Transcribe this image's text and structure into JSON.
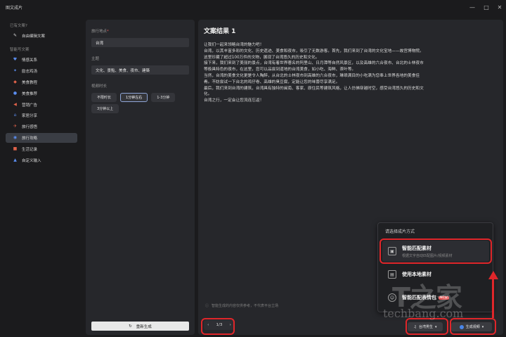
{
  "window": {
    "title": "图文成片",
    "controls": [
      "—",
      "□",
      "✕"
    ]
  },
  "sidebar": {
    "section_recent": "已有文案?",
    "recent_item": "自由编辑文案",
    "section_smart": "智能写文案",
    "items": [
      {
        "label": "情感关系",
        "icon": "heart-people-icon",
        "color": "#5b8def"
      },
      {
        "label": "励志鸡汤",
        "icon": "fitness-icon",
        "color": "#5b8def"
      },
      {
        "label": "美食教程",
        "icon": "food-icon",
        "color": "#e0624a"
      },
      {
        "label": "美食推荐",
        "icon": "food-recommend-icon",
        "color": "#5b8def"
      },
      {
        "label": "营销广告",
        "icon": "megaphone-icon",
        "color": "#e0624a"
      },
      {
        "label": "家居分享",
        "icon": "home-icon",
        "color": "#5b8def"
      },
      {
        "label": "旅行感悟",
        "icon": "travel-icon",
        "color": "#e0624a"
      },
      {
        "label": "旅行攻略",
        "icon": "globe-icon",
        "color": "#5b8def"
      },
      {
        "label": "生活记录",
        "icon": "life-icon",
        "color": "#e0624a"
      },
      {
        "label": "自定义输入",
        "icon": "custom-input-icon",
        "color": "#5b8def"
      }
    ],
    "active_index": 7
  },
  "form": {
    "location_label": "旅行地点",
    "location_value": "台湾",
    "theme_label": "主题",
    "theme_value": "文化、景點、美食、夜市、建築",
    "duration_label": "视频时长",
    "duration_options": [
      "不限时长",
      "1分钟左右",
      "1-3分钟",
      "3分钟以上"
    ],
    "duration_selected": 1,
    "regen_label": "重新生成",
    "regen_icon": "refresh-icon"
  },
  "result": {
    "title": "文案结果 1",
    "lines": [
      "让我们一起来领略台湾的魅力吧！",
      "台湾，以其丰富多彩的文化、历史遗迹、美食和夜市，吸引了无数游客。首先，我们来到了台湾的文化宝地——故宫博物院。",
      "这里珍藏了超过100万件的文物，展现了台湾悠久的历史和文化。",
      "接下来，我们来到了美丽的景点，台湾有着世界著名的阿里山、日月潭等自然风景区，以及高雄的六合夜市、台北的士林夜市",
      "等极具特色的夜市，在这里，您可以品尝到道地的台湾美食，如小吃、海鲜、茶叶等。",
      "当然，台湾的美食文化更是令人陶醉，从台北的士林夜市到高雄的六合夜市，琳琅满目的小吃满为您奉上世界各地的美食佳",
      "肴。不妨尝试一下台北的鸡仔卷、高雄的臭豆腐，定能让您的味蕾尽享满足。",
      "最后，我们来到台湾的建筑，台湾具有独特的闽南、客家、原住民等建筑风格，让人仿佛穿越时空，感受台湾悠久的历史和文",
      "化。",
      "台湾之行，一定会让您流连忘返！"
    ],
    "notice": "智能生成的内容仅供参考，不代表平台立场",
    "pager": {
      "prev": "‹",
      "text": "1/3",
      "next": "›"
    },
    "voice_button": "台湾男生",
    "generate_button": "生成视频"
  },
  "popup": {
    "title": "请选择成片方式",
    "options": [
      {
        "name": "智能匹配素材",
        "desc": "根据文字自动匹配图片/视频素材",
        "icon": "smart-match-icon",
        "badge": ""
      },
      {
        "name": "使用本地素材",
        "desc": "",
        "icon": "local-media-icon",
        "badge": ""
      },
      {
        "name": "智能匹配表情包",
        "desc": "",
        "icon": "emoji-icon",
        "badge": "NEW"
      }
    ]
  },
  "watermark": {
    "big": "T之家",
    "small": "techbang.com"
  },
  "colors": {
    "highlight": "#e0262a",
    "accent": "#4a86e8"
  }
}
